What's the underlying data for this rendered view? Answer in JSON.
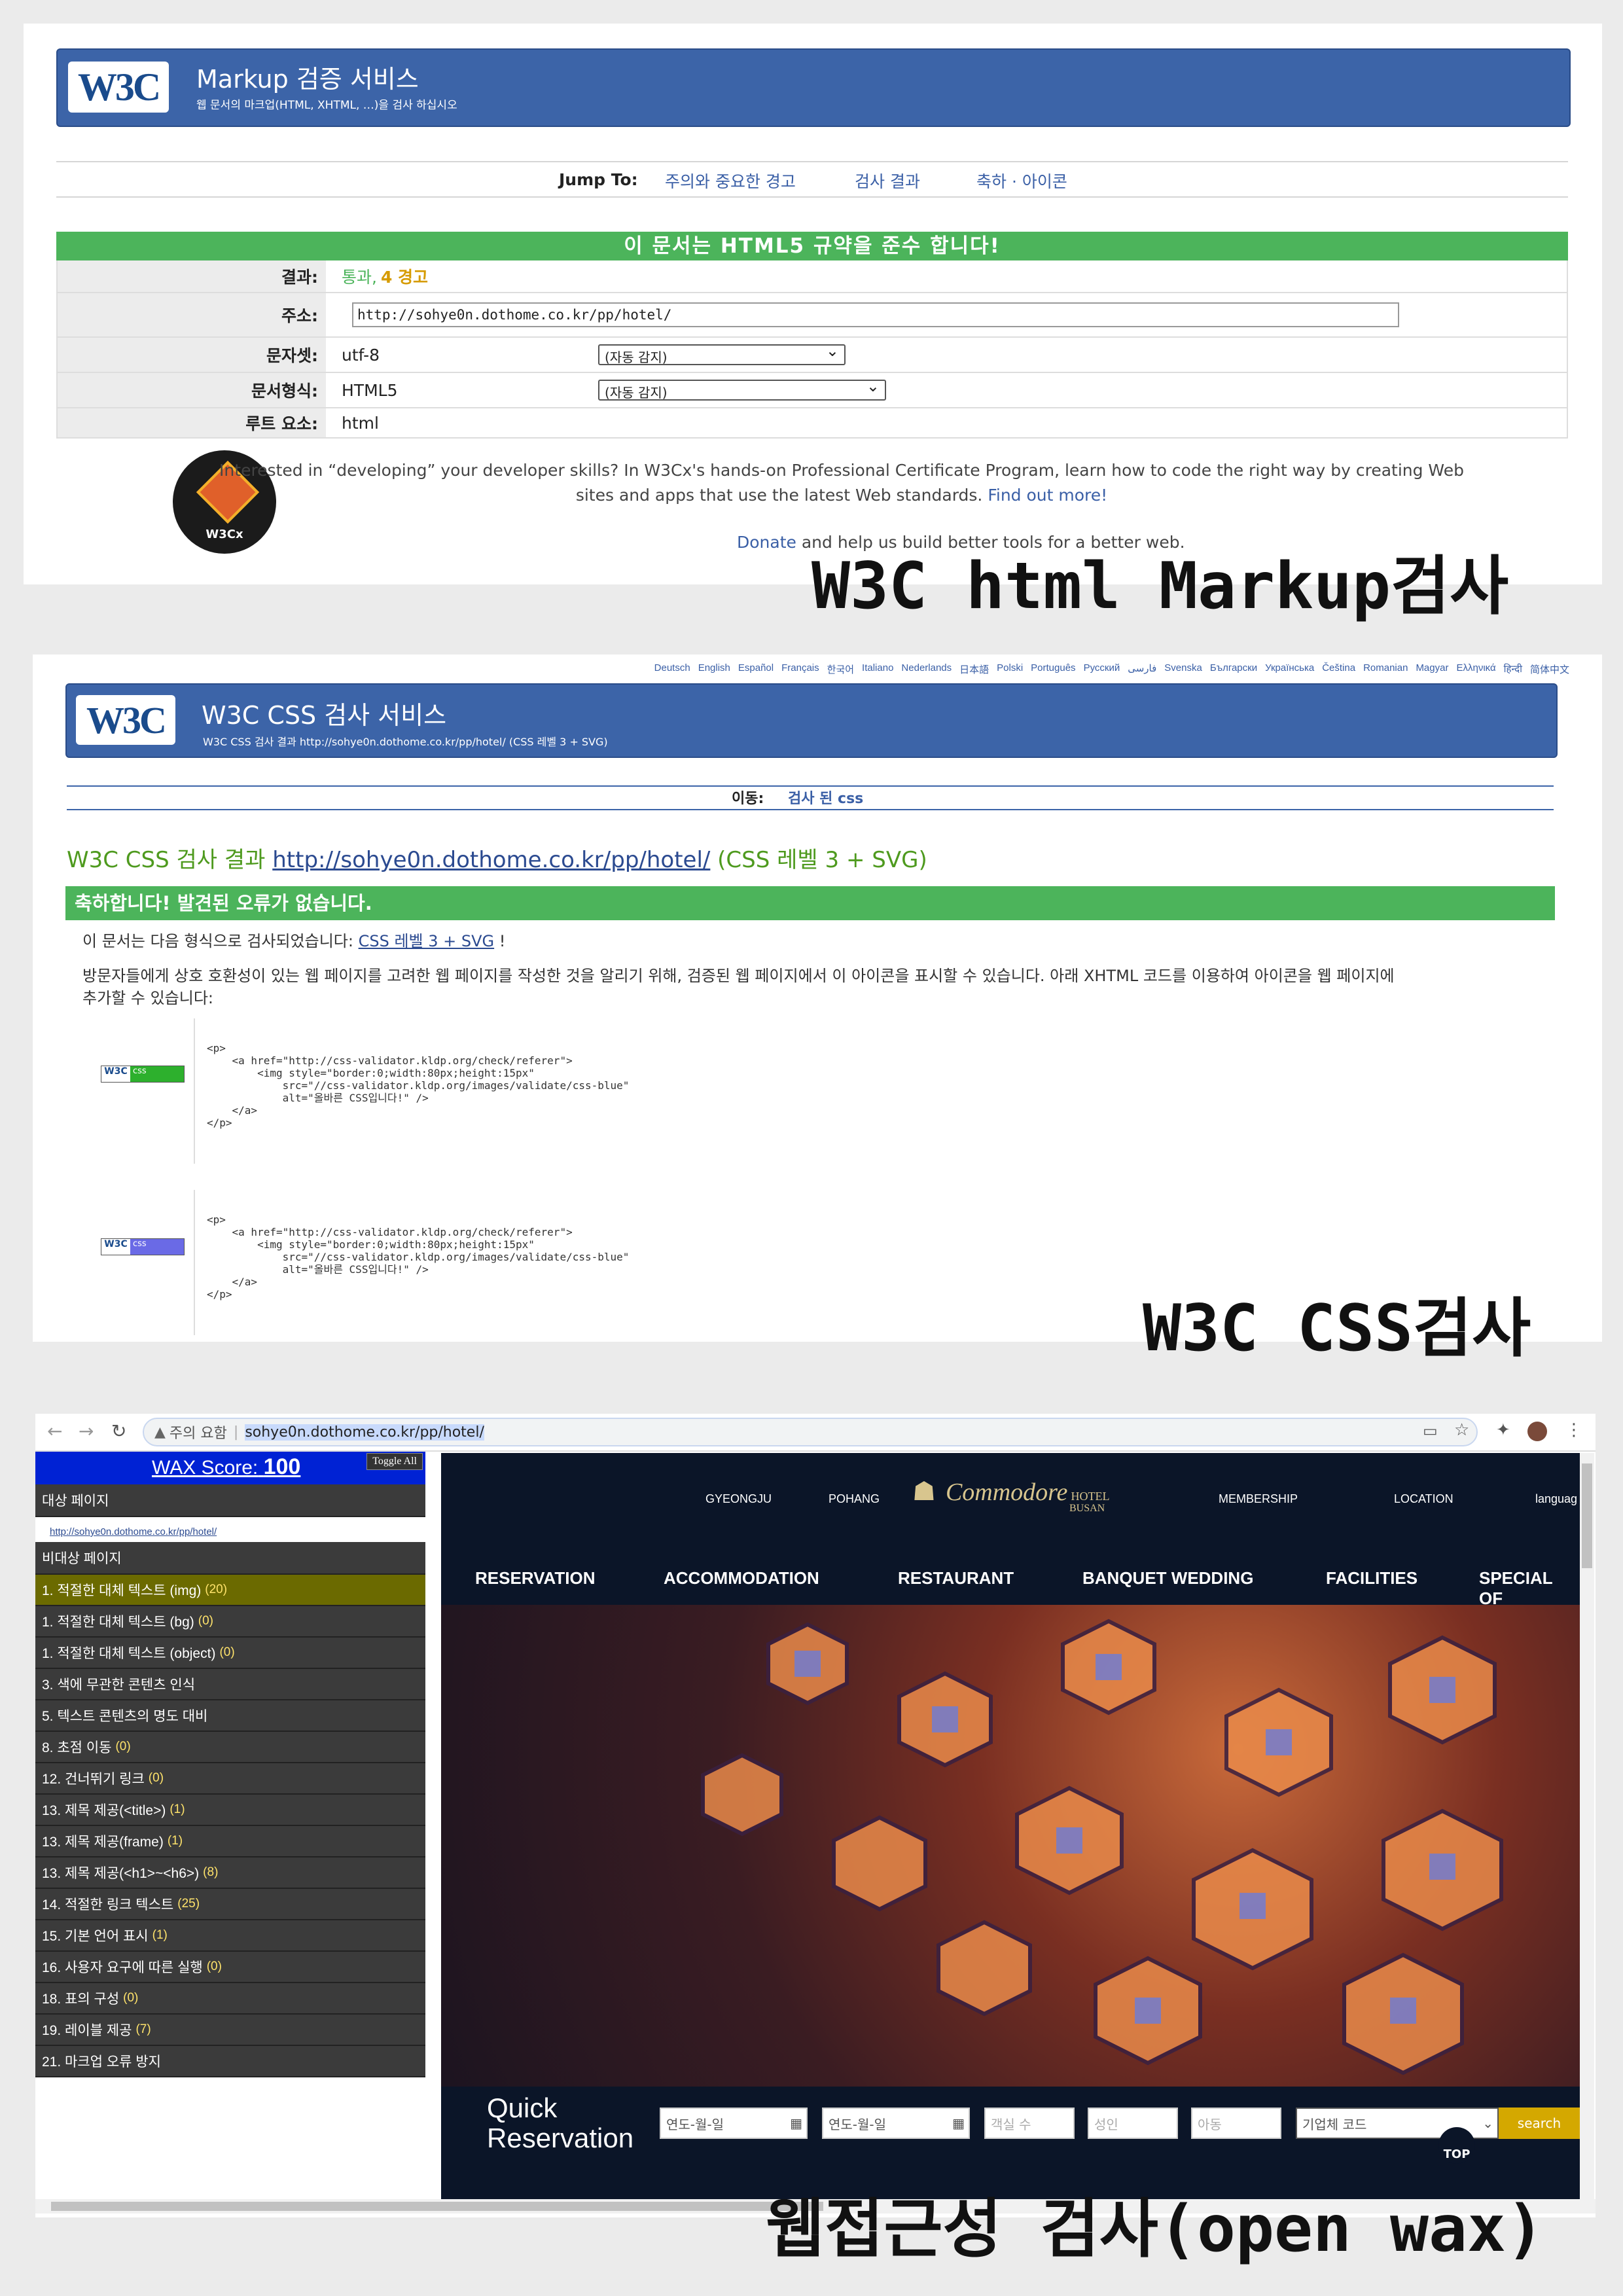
{
  "markup": {
    "logo": "W3C",
    "title": "Markup 검증 서비스",
    "subtitle": "웹 문서의 마크업(HTML, XHTML, …)을 검사 하십시오",
    "jump_to_label": "Jump To:",
    "jump_links": [
      "주의와 중요한 경고",
      "검사 결과",
      "축하 · 아이콘"
    ],
    "result_banner": "이 문서는 HTML5 규약을 준수 합니다!",
    "rows": {
      "result_label": "결과:",
      "result_pass": "통과,",
      "result_warn": "4 경고",
      "address_label": "주소:",
      "address_value": "http://sohye0n.dothome.co.kr/pp/hotel/",
      "charset_label": "문자셋:",
      "charset_value": "utf-8",
      "charset_select": "(자동 감지)",
      "doctype_label": "문서형식:",
      "doctype_value": "HTML5",
      "doctype_select": "(자동 감지)",
      "root_label": "루트 요소:",
      "root_value": "html"
    },
    "badge_text": "W3Cx",
    "promo_line1": "Interested in “developing” your developer skills? In W3Cx's hands-on Professional Certificate Program, learn how to code the right way by creating Web",
    "promo_line2": "sites and apps that use the latest Web standards.",
    "promo_link": "Find out more!",
    "donate_link": "Donate",
    "donate_text": "and help us build better tools for a better web.",
    "overlay_caption": "W3C html Markup검사"
  },
  "css": {
    "languages": [
      "Deutsch",
      "English",
      "Español",
      "Français",
      "한국어",
      "Italiano",
      "Nederlands",
      "日本語",
      "Polski",
      "Português",
      "Русский",
      "فارسی",
      "Svenska",
      "Български",
      "Українська",
      "Čeština",
      "Romanian",
      "Magyar",
      "Ελληνικά",
      "हिन्दी",
      "简体中文"
    ],
    "logo": "W3C",
    "title": "W3C CSS 검사 서비스",
    "subtitle": "W3C CSS 검사 결과 http://sohye0n.dothome.co.kr/pp/hotel/ (CSS 레벨 3 + SVG)",
    "nav_label": "이동:",
    "nav_link": "검사 된 css",
    "result_heading_prefix": "W3C CSS 검사 결과",
    "result_heading_link": "http://sohye0n.dothome.co.kr/pp/hotel/",
    "result_heading_suffix": "(CSS 레벨 3 + SVG)",
    "congrats": "축하합니다! 발견된 오류가 없습니다.",
    "validated_prefix": "이 문서는 다음 형식으로 검사되었습니다:",
    "validated_link": "CSS 레벨 3 + SVG",
    "validated_suffix": "!",
    "explain_line1": "방문자들에게 상호 호환성이 있는 웹 페이지를 고려한 웹 페이지를 작성한 것을 알리기 위해, 검증된 웹 페이지에서 이 아이콘을 표시할 수 있습니다. 아래 XHTML 코드를 이용하여 아이콘을 웹 페이지에",
    "explain_line2": "추가할 수 있습니다:",
    "badge_w3c": "W3C",
    "badge_css": "css",
    "code_1": "<p>\n    <a href=\"http://css-validator.kldp.org/check/referer\">\n        <img style=\"border:0;width:80px;height:15px\"\n            src=\"//css-validator.kldp.org/images/validate/css-blue\"\n            alt=\"올바른 CSS입니다!\" />\n    </a>\n</p>",
    "code_2": "<p>\n    <a href=\"http://css-validator.kldp.org/check/referer\">\n        <img style=\"border:0;width:80px;height:15px\"\n            src=\"//css-validator.kldp.org/images/validate/css-blue\"\n            alt=\"올바른 CSS입니다!\" />\n    </a>\n</p>",
    "overlay_caption": "W3C CSS검사"
  },
  "wax": {
    "address_prefix": "주의 요함",
    "address_url": "sohye0n.dothome.co.kr/pp/hotel/",
    "score_label": "WAX Score:",
    "score_value": "100",
    "toggle_all": "Toggle All",
    "target_header": "대상 페이지",
    "target_url": "http://sohye0n.dothome.co.kr/pp/hotel/",
    "non_target_header": "비대상 페이지",
    "items": [
      {
        "label": "1. 적절한 대체 텍스트 (img)",
        "count": "(20)",
        "highlight": true
      },
      {
        "label": "1. 적절한 대체 텍스트 (bg)",
        "count": "(0)"
      },
      {
        "label": "1. 적절한 대체 텍스트 (object)",
        "count": "(0)"
      },
      {
        "label": "3. 색에 무관한 콘텐츠 인식",
        "count": ""
      },
      {
        "label": "5. 텍스트 콘텐츠의 명도 대비",
        "count": ""
      },
      {
        "label": "8. 초점 이동",
        "count": "(0)"
      },
      {
        "label": "12. 건너뛰기 링크",
        "count": "(0)"
      },
      {
        "label": "13. 제목 제공(<title>)",
        "count": "(1)"
      },
      {
        "label": "13. 제목 제공(frame)",
        "count": "(1)"
      },
      {
        "label": "13. 제목 제공(<h1>~<h6>)",
        "count": "(8)"
      },
      {
        "label": "14. 적절한 링크 텍스트",
        "count": "(25)"
      },
      {
        "label": "15. 기본 언어 표시",
        "count": "(1)"
      },
      {
        "label": "16. 사용자 요구에 따른 실행",
        "count": "(0)"
      },
      {
        "label": "18. 표의 구성",
        "count": "(0)"
      },
      {
        "label": "19. 레이블 제공",
        "count": "(7)"
      },
      {
        "label": "21. 마크업 오류 방지",
        "count": ""
      }
    ],
    "site": {
      "top_nav": [
        "GYEONGJU",
        "POHANG",
        "MEMBERSHIP",
        "LOCATION",
        "languag"
      ],
      "logo_text": "Commodore",
      "logo_hotel": "HOTEL",
      "logo_city": "BUSAN",
      "main_nav": [
        "RESERVATION",
        "ACCOMMODATION",
        "RESTAURANT",
        "BANQUET WEDDING",
        "FACILITIES",
        "SPECIAL OF"
      ],
      "quick_line1": "Quick",
      "quick_line2": "Reservation",
      "date_placeholder": "연도-월-일",
      "rooms_placeholder": "객실 수",
      "adult_placeholder": "성인",
      "child_placeholder": "아동",
      "corp_placeholder": "기업체 코드",
      "search_label": "search",
      "top_label": "TOP"
    },
    "overlay_caption": "웹접근성 검사(open wax)"
  }
}
